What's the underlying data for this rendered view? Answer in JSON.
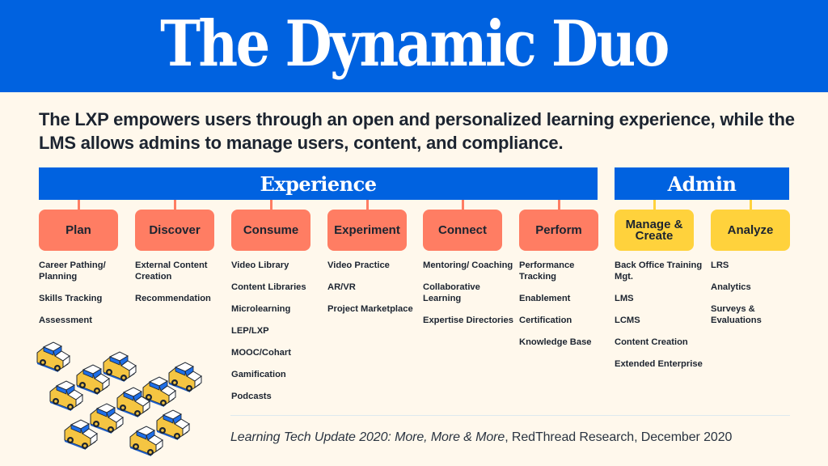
{
  "title": "The Dynamic Duo",
  "subtitle": "The LXP empowers users through an open and personalized learning experience, while the LMS allows admins to manage users, content, and compliance.",
  "colors": {
    "banner_blue": "#0062e0",
    "experience_stage": "#ff7d63",
    "admin_stage": "#ffd23c",
    "background": "#fff8ec",
    "text": "#1c2430"
  },
  "categories": {
    "experience": {
      "label": "Experience"
    },
    "admin": {
      "label": "Admin"
    }
  },
  "stages": [
    {
      "label": "Plan",
      "group": "experience",
      "items": [
        "Career Pathing/ Planning",
        "Skills Tracking",
        "Assessment"
      ]
    },
    {
      "label": "Discover",
      "group": "experience",
      "items": [
        "External Content Creation",
        "Recommendation"
      ]
    },
    {
      "label": "Consume",
      "group": "experience",
      "items": [
        "Video Library",
        "Content Libraries",
        "Microlearning",
        "LEP/LXP",
        "MOOC/Cohart",
        "Gamification",
        "Podcasts"
      ]
    },
    {
      "label": "Experiment",
      "group": "experience",
      "items": [
        "Video Practice",
        "AR/VR",
        "Project Marketplace"
      ]
    },
    {
      "label": "Connect",
      "group": "experience",
      "items": [
        "Mentoring/ Coaching",
        "Collaborative Learning",
        "Expertise Directories"
      ]
    },
    {
      "label": "Perform",
      "group": "experience",
      "items": [
        "Performance Tracking",
        "Enablement",
        "Certification",
        "Knowledge Base"
      ]
    },
    {
      "label": "Manage & Create",
      "group": "admin",
      "items": [
        "Back Office Training Mgt.",
        "LMS",
        "LCMS",
        "Content Creation",
        "Extended Enterprise"
      ]
    },
    {
      "label": "Analyze",
      "group": "admin",
      "items": [
        "LRS",
        "Analytics",
        "Surveys & Evaluations"
      ]
    }
  ],
  "illustration": {
    "icon": "car-icon",
    "count": 12
  },
  "citation": {
    "italic": "Learning Tech Update 2020: More, More & More",
    "rest": ", RedThread Research, December 2020"
  }
}
